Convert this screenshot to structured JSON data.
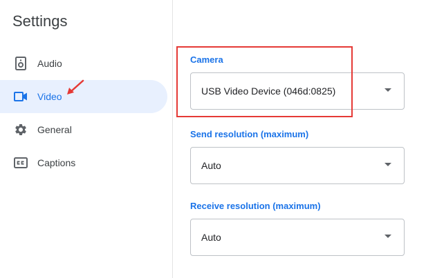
{
  "sidebar": {
    "title": "Settings",
    "items": [
      {
        "label": "Audio",
        "icon": "speaker-icon"
      },
      {
        "label": "Video",
        "icon": "video-camera-icon",
        "selected": true
      },
      {
        "label": "General",
        "icon": "gear-icon"
      },
      {
        "label": "Captions",
        "icon": "closed-captions-icon"
      }
    ]
  },
  "main": {
    "camera": {
      "label": "Camera",
      "value": "USB Video Device (046d:0825)"
    },
    "send_resolution": {
      "label": "Send resolution (maximum)",
      "value": "Auto"
    },
    "receive_resolution": {
      "label": "Receive resolution (maximum)",
      "value": "Auto"
    }
  },
  "colors": {
    "accent": "#1a73e8",
    "selected_bg": "#e8f0fe",
    "annotation": "#e53935"
  }
}
